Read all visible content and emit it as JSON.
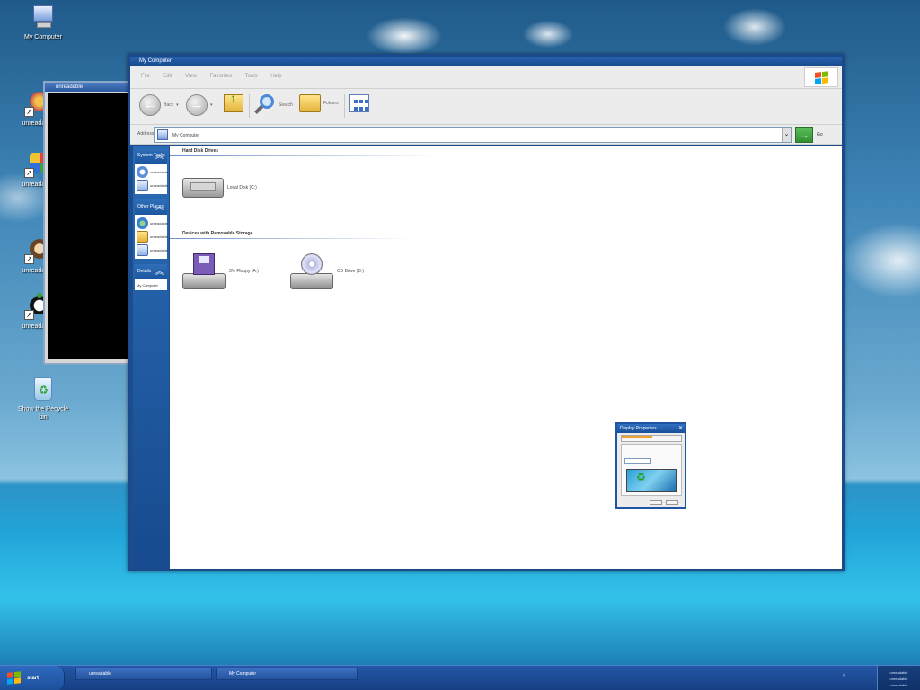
{
  "desktop": {
    "icons": [
      {
        "label": "My Computer"
      },
      {
        "label": "unreadable"
      },
      {
        "label": "unreadable"
      },
      {
        "label": "unreadable"
      },
      {
        "label": "unreadable"
      },
      {
        "label": "Show the Recycle bin"
      }
    ]
  },
  "background_window": {
    "title": "unreadable"
  },
  "main_window": {
    "title": "My Computer",
    "menu": [
      "File",
      "Edit",
      "View",
      "Favorites",
      "Tools",
      "Help"
    ],
    "toolbar": {
      "back": "Back",
      "forward": "Forward",
      "search": "Search",
      "folders": "Folders"
    },
    "address": {
      "label": "Address",
      "value": "My Computer",
      "go": "Go"
    },
    "sidebar": {
      "panels": [
        {
          "title": "System Tasks",
          "items": [
            "unreadable",
            "unreadable"
          ]
        },
        {
          "title": "Other Places",
          "items": [
            "unreadable",
            "unreadable",
            "unreadable"
          ]
        },
        {
          "title": "Details",
          "items": [
            "My Computer"
          ]
        }
      ]
    },
    "groups": {
      "hard_disks": "Hard Disk Drives",
      "removable": "Devices with Removable Storage"
    },
    "drives": {
      "c": "Local Disk (C:)",
      "a": "3½ Floppy (A:)",
      "d": "CD Drive (D:)"
    }
  },
  "display_properties": {
    "title": "Display Properties"
  },
  "taskbar": {
    "start": "start",
    "tasks": [
      "unreadable",
      "My Computer"
    ],
    "clock": [
      "unreadable",
      "unreadable",
      "unreadable"
    ]
  },
  "colors": {
    "taskbar": "#2458a8",
    "sidebar": "#1d56a0",
    "go_button": "#2e8f2e"
  }
}
